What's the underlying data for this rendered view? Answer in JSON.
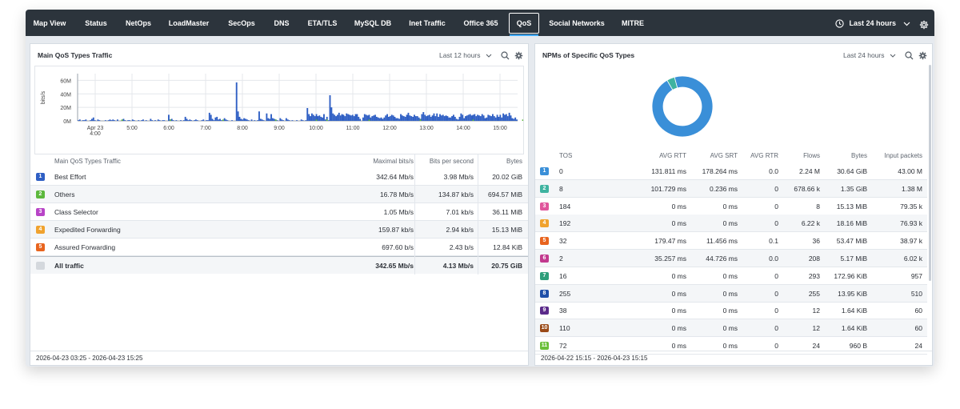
{
  "nav": {
    "tabs": [
      {
        "label": "Map View"
      },
      {
        "label": "Status"
      },
      {
        "label": "NetOps"
      },
      {
        "label": "LoadMaster"
      },
      {
        "label": "SecOps"
      },
      {
        "label": "DNS"
      },
      {
        "label": "ETA/TLS"
      },
      {
        "label": "MySQL DB"
      },
      {
        "label": "Inet Traffic"
      },
      {
        "label": "Office 365"
      },
      {
        "label": "QoS"
      },
      {
        "label": "Social Networks"
      },
      {
        "label": "MITRE"
      }
    ],
    "active_tab": "QoS",
    "time_range": "Last 24 hours",
    "icons": {
      "clock": "clock-icon",
      "chevron": "chevron-down-icon",
      "settings": "gear-icon"
    }
  },
  "left_panel": {
    "title": "Main QoS Types Traffic",
    "range": "Last 12 hours",
    "columns": [
      "Main QoS Types Traffic",
      "Maximal bits/s",
      "Bits per second",
      "Bytes"
    ],
    "rows": [
      {
        "num": "1",
        "color": "#2f5fc4",
        "name": "Best Effort",
        "max": "342.64 Mb/s",
        "bps": "3.98 Mb/s",
        "bytes": "20.02 GiB"
      },
      {
        "num": "2",
        "color": "#5cb83c",
        "name": "Others",
        "max": "16.78 Mb/s",
        "bps": "134.87 kb/s",
        "bytes": "694.57 MiB"
      },
      {
        "num": "3",
        "color": "#b844c7",
        "name": "Class Selector",
        "max": "1.05 Mb/s",
        "bps": "7.01 kb/s",
        "bytes": "36.11 MiB"
      },
      {
        "num": "4",
        "color": "#f0a22e",
        "name": "Expedited Forwarding",
        "max": "159.87 kb/s",
        "bps": "2.94 kb/s",
        "bytes": "15.13 MiB"
      },
      {
        "num": "5",
        "color": "#e8641e",
        "name": "Assured Forwarding",
        "max": "697.60 b/s",
        "bps": "2.43 b/s",
        "bytes": "12.84 KiB"
      }
    ],
    "total": {
      "name": "All traffic",
      "max": "342.65 Mb/s",
      "bps": "4.13 Mb/s",
      "bytes": "20.75 GiB"
    },
    "footer": "2026-04-23 03:25 - 2026-04-23 15:25"
  },
  "right_panel": {
    "title": "NPMs of Specific QoS Types",
    "range": "Last 24 hours",
    "columns": [
      "TOS",
      "AVG RTT",
      "AVG SRT",
      "AVG RTR",
      "Flows",
      "Bytes",
      "Input packets"
    ],
    "rows": [
      {
        "num": "1",
        "color": "#3a8fd8",
        "tos": "0",
        "rtt": "131.811 ms",
        "srt": "178.264 ms",
        "rtr": "0.0",
        "flows": "2.24 M",
        "bytes": "30.64 GiB",
        "pkts": "43.00 M"
      },
      {
        "num": "2",
        "color": "#3fb3a0",
        "tos": "8",
        "rtt": "101.729 ms",
        "srt": "0.236 ms",
        "rtr": "0",
        "flows": "678.66 k",
        "bytes": "1.35 GiB",
        "pkts": "1.38 M"
      },
      {
        "num": "3",
        "color": "#e0559c",
        "tos": "184",
        "rtt": "0 ms",
        "srt": "0 ms",
        "rtr": "0",
        "flows": "8",
        "bytes": "15.13 MiB",
        "pkts": "79.35 k"
      },
      {
        "num": "4",
        "color": "#f0a22e",
        "tos": "192",
        "rtt": "0 ms",
        "srt": "0 ms",
        "rtr": "0",
        "flows": "6.22 k",
        "bytes": "18.16 MiB",
        "pkts": "76.93 k"
      },
      {
        "num": "5",
        "color": "#e8641e",
        "tos": "32",
        "rtt": "179.47 ms",
        "srt": "11.456 ms",
        "rtr": "0.1",
        "flows": "36",
        "bytes": "53.47 MiB",
        "pkts": "38.97 k"
      },
      {
        "num": "6",
        "color": "#c23a8e",
        "tos": "2",
        "rtt": "35.257 ms",
        "srt": "44.726 ms",
        "rtr": "0.0",
        "flows": "208",
        "bytes": "5.17 MiB",
        "pkts": "6.02 k"
      },
      {
        "num": "7",
        "color": "#2e9e7a",
        "tos": "16",
        "rtt": "0 ms",
        "srt": "0 ms",
        "rtr": "0",
        "flows": "293",
        "bytes": "172.96 KiB",
        "pkts": "957"
      },
      {
        "num": "8",
        "color": "#1e4fa8",
        "tos": "255",
        "rtt": "0 ms",
        "srt": "0 ms",
        "rtr": "0",
        "flows": "255",
        "bytes": "13.95 KiB",
        "pkts": "510"
      },
      {
        "num": "9",
        "color": "#5a2a8a",
        "tos": "38",
        "rtt": "0 ms",
        "srt": "0 ms",
        "rtr": "0",
        "flows": "12",
        "bytes": "1.64 KiB",
        "pkts": "60"
      },
      {
        "num": "10",
        "color": "#9a4a18",
        "tos": "110",
        "rtt": "0 ms",
        "srt": "0 ms",
        "rtr": "0",
        "flows": "12",
        "bytes": "1.64 KiB",
        "pkts": "60"
      },
      {
        "num": "11",
        "color": "#6abf3a",
        "tos": "72",
        "rtt": "0 ms",
        "srt": "0 ms",
        "rtr": "0",
        "flows": "24",
        "bytes": "960 B",
        "pkts": "24"
      }
    ],
    "footer": "2026-04-22 15:15 - 2026-04-23 15:15",
    "donut": {
      "values": [
        30.64,
        1.35
      ],
      "colors": [
        "#3a8fd8",
        "#3fb3a0"
      ]
    }
  },
  "chart_data": {
    "type": "bar",
    "ylabel": "bits/s",
    "yticks": [
      "0M",
      "20M",
      "40M",
      "60M"
    ],
    "ylim": [
      0,
      70
    ],
    "xticks": [
      "Apr 23\n4:00",
      "5:00",
      "6:00",
      "7:00",
      "8:00",
      "9:00",
      "10:00",
      "11:00",
      "12:00",
      "13:00",
      "14:00",
      "15:00"
    ],
    "grid": true,
    "series": [
      {
        "color": "#2f5fc4",
        "values": [
          1,
          2,
          0,
          1,
          1,
          2,
          0,
          0,
          1,
          3,
          5,
          1,
          0,
          2,
          1,
          0,
          0,
          0,
          1,
          0,
          1,
          2,
          1,
          2,
          1,
          0,
          2,
          0,
          0,
          1,
          3,
          1,
          0,
          1,
          1,
          0,
          2,
          1,
          0,
          0,
          1,
          0,
          1,
          2,
          0,
          1,
          0,
          0,
          3,
          1,
          0,
          1,
          0,
          2,
          1,
          0,
          1,
          1,
          0,
          0,
          9,
          2,
          3,
          1,
          0,
          1,
          0,
          0,
          1,
          0,
          1,
          6,
          3,
          1,
          2,
          1,
          0,
          1,
          2,
          1,
          0,
          0,
          1,
          2,
          0,
          1,
          1,
          12,
          9,
          3,
          1,
          5,
          6,
          2,
          3,
          1,
          0,
          4,
          2,
          1,
          0,
          0,
          1,
          0,
          0,
          57,
          14,
          6,
          3,
          2,
          4,
          3,
          2,
          1,
          0,
          2,
          0,
          1,
          0,
          1,
          14,
          3,
          2,
          1,
          0,
          11,
          4,
          3,
          10,
          4,
          3,
          2,
          1,
          0,
          4,
          2,
          1,
          0,
          4,
          2,
          1,
          0,
          1,
          0,
          0,
          1,
          0,
          0,
          2,
          1,
          0,
          1,
          19,
          10,
          7,
          11,
          9,
          7,
          10,
          7,
          8,
          6,
          5,
          10,
          2,
          6,
          1,
          38,
          20,
          11,
          9,
          7,
          9,
          12,
          8,
          10,
          9,
          7,
          11,
          10,
          9,
          8,
          9,
          7,
          10,
          10,
          6,
          3,
          0,
          5,
          10,
          9,
          8,
          9,
          5,
          7,
          8,
          9,
          6,
          5,
          4,
          5,
          3,
          5,
          8,
          10,
          6,
          7,
          9,
          8,
          6,
          4,
          4,
          3,
          10,
          8,
          7,
          6,
          9,
          12,
          8,
          7,
          6,
          9,
          7,
          7,
          5,
          3,
          10,
          13,
          9,
          7,
          8,
          9,
          6,
          8,
          11,
          7,
          11,
          6,
          10,
          8,
          9,
          7,
          8,
          7,
          5,
          5,
          7,
          9,
          6,
          3,
          2,
          6,
          11,
          9,
          4,
          7,
          8,
          9,
          10,
          8,
          9,
          10,
          7,
          9,
          8,
          7,
          10,
          8,
          4,
          5,
          9,
          8,
          7,
          10,
          7,
          5,
          9,
          6,
          9,
          5,
          11,
          9,
          10,
          7,
          12,
          8,
          4,
          3,
          5,
          2
        ]
      },
      {
        "color": "#5cb83c",
        "values": {
          "29": 2,
          "61": 2,
          "96": 2,
          "131": 2,
          "158": 2,
          "165": 2,
          "193": 2,
          "227": 2,
          "262": 2,
          "295": 2
        }
      }
    ]
  }
}
